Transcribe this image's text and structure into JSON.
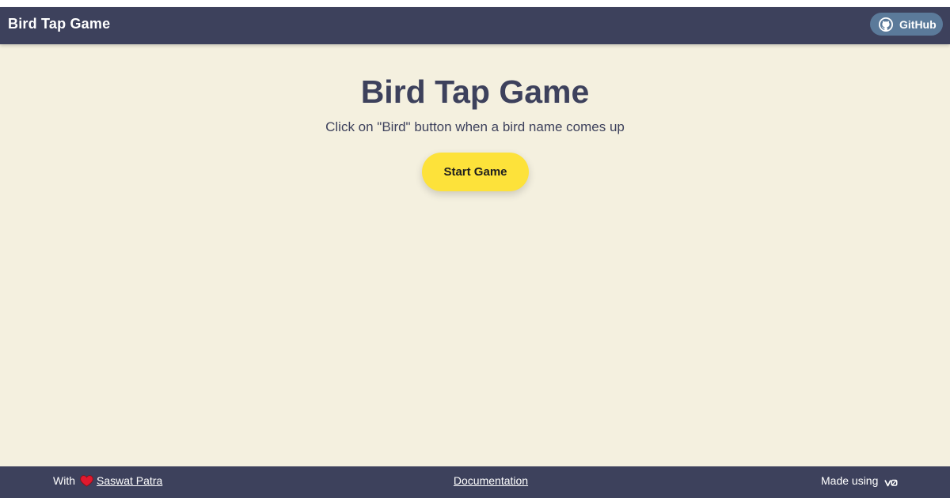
{
  "header": {
    "title": "Bird Tap Game",
    "github_label": "GitHub"
  },
  "main": {
    "title": "Bird Tap Game",
    "subtitle": "Click on \"Bird\" button when a bird name comes up",
    "start_label": "Start Game"
  },
  "footer": {
    "with_label": "With",
    "author": "Saswat Patra",
    "docs_label": "Documentation",
    "made_using_label": "Made using"
  },
  "icons": {
    "github": "github-icon",
    "heart": "heart-icon",
    "v0": "v0-logo"
  },
  "colors": {
    "header_bg": "#3d415c",
    "page_bg": "#f4f0df",
    "accent": "#fde23a",
    "github_btn": "#5b7a9a",
    "heart": "#e0192e"
  }
}
